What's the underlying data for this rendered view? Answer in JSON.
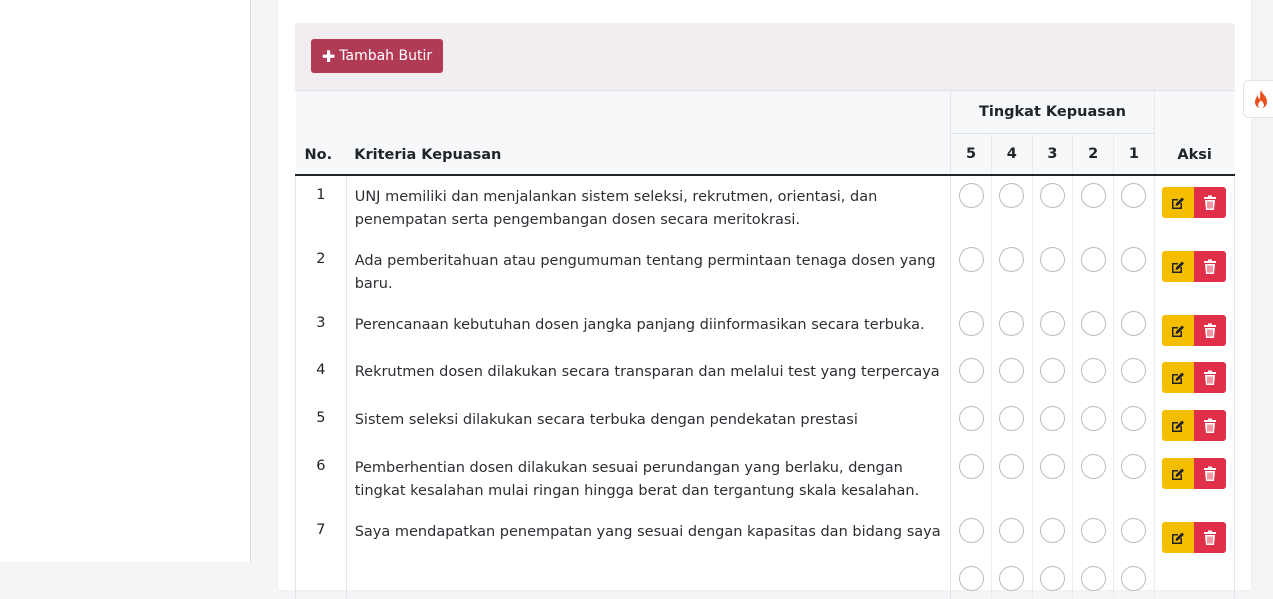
{
  "toolbar": {
    "add_label": "Tambah Butir"
  },
  "table": {
    "col_no": "No.",
    "col_criteria": "Kriteria Kepuasan",
    "col_group": "Tingkat Kepuasan",
    "levels": [
      "5",
      "4",
      "3",
      "2",
      "1"
    ],
    "col_action": "Aksi",
    "rows": [
      {
        "no": "1",
        "text": "UNJ memiliki dan menjalankan sistem seleksi, rekrutmen, orientasi, dan penempatan serta pengembangan dosen secara meritokrasi."
      },
      {
        "no": "2",
        "text": "Ada pemberitahuan atau pengumuman tentang permintaan tenaga dosen yang baru."
      },
      {
        "no": "3",
        "text": "Perencanaan kebutuhan dosen jangka panjang diinformasikan secara terbuka."
      },
      {
        "no": "4",
        "text": "Rekrutmen dosen dilakukan secara transparan dan melalui test yang terpercaya"
      },
      {
        "no": "5",
        "text": "Sistem seleksi dilakukan secara terbuka dengan pendekatan prestasi"
      },
      {
        "no": "6",
        "text": "Pemberhentian dosen dilakukan sesuai perundangan yang berlaku, dengan tingkat kesalahan mulai ringan hingga berat dan tergantung skala kesalahan."
      },
      {
        "no": "7",
        "text": "Saya mendapatkan penempatan yang sesuai dengan kapasitas dan bidang saya"
      },
      {
        "no": "",
        "text": ""
      }
    ]
  },
  "colors": {
    "primary_button": "#b13a55",
    "edit_button": "#f5bf00",
    "delete_button": "#e03049",
    "fab_icon": "#e8501d"
  },
  "icons": {
    "add": "plus-icon",
    "edit": "edit-icon",
    "delete": "trash-icon",
    "fab": "fire-icon"
  }
}
